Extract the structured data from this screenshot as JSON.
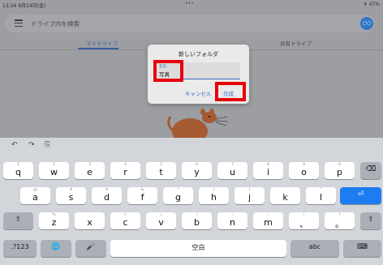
{
  "status": {
    "time": "13:34  9月14日(金)",
    "dots": "•••",
    "right": "✈ 47%"
  },
  "drive": {
    "search_placeholder": "ドライブ内を検索",
    "avatar_text": "○○",
    "tabs": [
      {
        "label": "マイドライブ"
      },
      {
        "label": "共有ドライブ"
      }
    ]
  },
  "dialog": {
    "title": "新しいフォルダ",
    "field_label": "名前",
    "field_value": "写真",
    "cancel_label": "キャンセル",
    "create_label": "作成",
    "highlight_color": "#e8000b"
  },
  "keyboard": {
    "toolbar": {
      "undo": "↶",
      "redo": "↷",
      "paste": "⎘"
    },
    "row1": [
      {
        "hint": "1",
        "key": "q"
      },
      {
        "hint": "2",
        "key": "w"
      },
      {
        "hint": "3",
        "key": "e"
      },
      {
        "hint": "4",
        "key": "r"
      },
      {
        "hint": "5",
        "key": "t"
      },
      {
        "hint": "6",
        "key": "y"
      },
      {
        "hint": "7",
        "key": "u"
      },
      {
        "hint": "8",
        "key": "i"
      },
      {
        "hint": "9",
        "key": "o"
      },
      {
        "hint": "0",
        "key": "p"
      }
    ],
    "row2": [
      {
        "hint": "@",
        "key": "a"
      },
      {
        "hint": "#",
        "key": "s"
      },
      {
        "hint": "¥",
        "key": "d"
      },
      {
        "hint": "&",
        "key": "f"
      },
      {
        "hint": "*",
        "key": "g"
      },
      {
        "hint": "(",
        "key": "h"
      },
      {
        "hint": ")",
        "key": "j"
      },
      {
        "hint": "'",
        "key": "k"
      },
      {
        "hint": "\"",
        "key": "l"
      }
    ],
    "row3": [
      {
        "hint": "%",
        "key": "z"
      },
      {
        "hint": "-",
        "key": "x"
      },
      {
        "hint": "+",
        "key": "c"
      },
      {
        "hint": "=",
        "key": "v"
      },
      {
        "hint": "/",
        "key": "b"
      },
      {
        "hint": ";",
        "key": "n"
      },
      {
        "hint": ":",
        "key": "m"
      },
      {
        "hint": "!",
        "key": "、"
      },
      {
        "hint": "?",
        "key": "。"
      }
    ],
    "delete": "⌫",
    "return": "⏎",
    "shift": "⇧",
    "numbers": ".?123",
    "globe": "🌐",
    "mic": "🎤",
    "space": "空白",
    "abc": "abc",
    "hide": "⌨",
    "accent_color": "#1d7cf2"
  }
}
